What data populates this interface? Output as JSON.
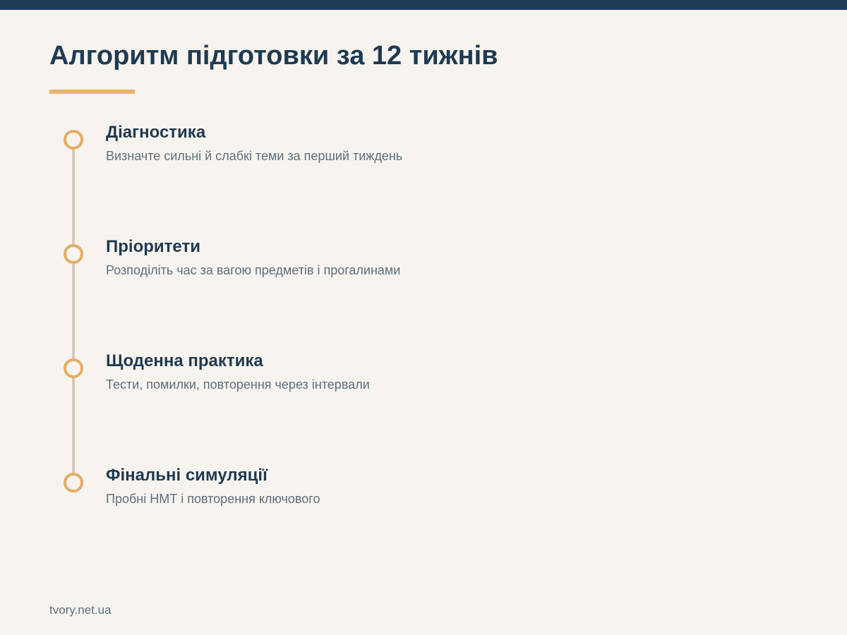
{
  "header": {
    "title": "Алгоритм підготовки за 12 тижнів"
  },
  "steps": [
    {
      "title": "Діагностика",
      "description": "Визначте сильні й слабкі теми за перший тиждень"
    },
    {
      "title": "Пріоритети",
      "description": "Розподіліть час за вагою предметів і прогалинами"
    },
    {
      "title": "Щоденна практика",
      "description": "Тести, помилки, повторення через інтервали"
    },
    {
      "title": "Фінальні симуляції",
      "description": "Пробні НМТ і повторення ключового"
    }
  ],
  "footer": {
    "site": "tvory.net.ua"
  },
  "colors": {
    "navy": "#1f3a52",
    "accent": "#e8b36e",
    "background": "#f7f3ee",
    "muted": "#5d6f80"
  }
}
